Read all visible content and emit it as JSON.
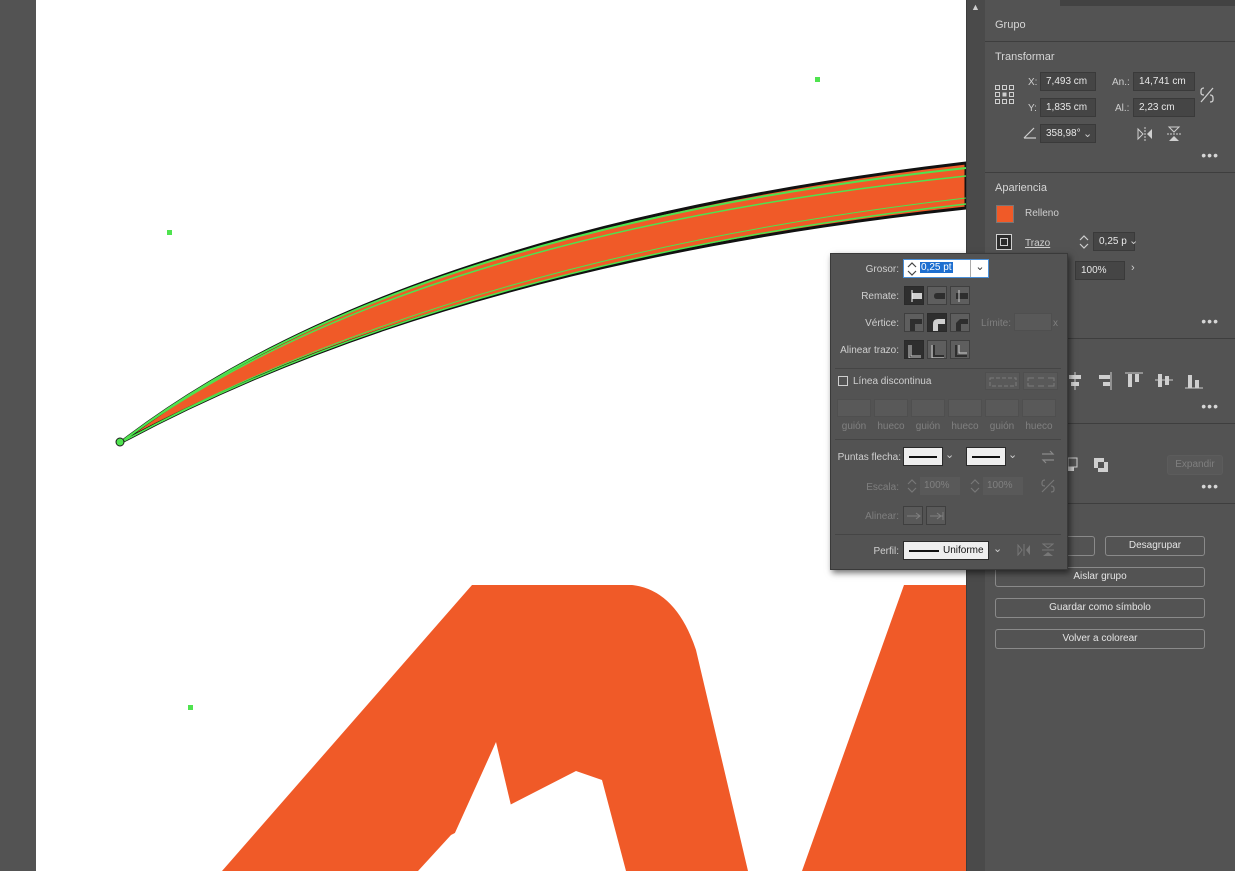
{
  "panel": {
    "group_title": "Grupo",
    "transform": {
      "title": "Transformar",
      "x_label": "X:",
      "x_value": "7,493 cm",
      "y_label": "Y:",
      "y_value": "1,835 cm",
      "w_label": "An.:",
      "w_value": "14,741 cm",
      "h_label": "Al.:",
      "h_value": "2,23 cm",
      "angle_value": "358,98°"
    },
    "appearance": {
      "title": "Apariencia",
      "fill_label": "Relleno",
      "stroke_label": "Trazo",
      "stroke_value": "0,25 p",
      "opacity_value": "100%",
      "fill_color": "#f05a28"
    },
    "buttons": {
      "ungroup": "Desagrupar",
      "isolate": "Aislar grupo",
      "save_symbol": "Guardar como símbolo",
      "recolor": "Volver a colorear",
      "expand": "Expandir"
    }
  },
  "stroke_popup": {
    "weight_label": "Grosor:",
    "weight_value": "0,25 pt",
    "cap_label": "Remate:",
    "corner_label": "Vértice:",
    "limit_label": "Límite:",
    "limit_suffix": "x",
    "align_label": "Alinear trazo:",
    "dashed_label": "Línea discontinua",
    "dash_labels": [
      "guión",
      "hueco",
      "guión",
      "hueco",
      "guión",
      "hueco"
    ],
    "arrowheads_label": "Puntas flecha:",
    "scale_label": "Escala:",
    "scale_value_1": "100%",
    "scale_value_2": "100%",
    "align_arrows_label": "Alinear:",
    "profile_label": "Perfil:",
    "profile_value": "Uniforme"
  },
  "colors": {
    "art_orange": "#f05a28",
    "selection_green": "#4fe34f"
  }
}
